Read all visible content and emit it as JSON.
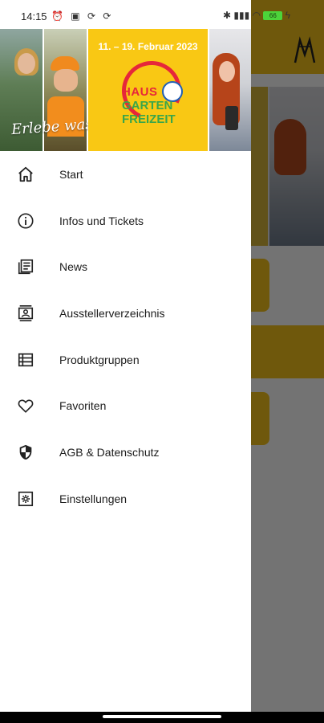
{
  "status_bar": {
    "time": "14:15",
    "left_icons": [
      "alarm-icon",
      "qr-icon",
      "sync-icon",
      "sync-icon"
    ],
    "right_icons": [
      "bluetooth-icon",
      "signal-icon",
      "wifi-icon"
    ],
    "battery": "66"
  },
  "header": {
    "script_text": "Erlebe was geht",
    "dates": "11. – 19. Februar 2023",
    "logo_line1": "HAUS",
    "logo_line2": "GARTEN",
    "logo_line3": "FREIZEIT",
    "colors": {
      "yellow": "#f9c814",
      "logo_red": "#e6273a",
      "logo_green": "#3aa64a"
    }
  },
  "menu": {
    "items": [
      {
        "label": "Start",
        "icon": "home-icon"
      },
      {
        "label": "Infos und Tickets",
        "icon": "info-icon"
      },
      {
        "label": "News",
        "icon": "news-icon"
      },
      {
        "label": "Ausstellerverzeichnis",
        "icon": "contact-card-icon"
      },
      {
        "label": "Produktgruppen",
        "icon": "list-icon"
      },
      {
        "label": "Favoriten",
        "icon": "heart-icon"
      },
      {
        "label": "AGB & Datenschutz",
        "icon": "shield-icon"
      },
      {
        "label": "Einstellungen",
        "icon": "settings-icon"
      }
    ]
  },
  "background_app": {
    "accent_color": "#f5c31c"
  }
}
